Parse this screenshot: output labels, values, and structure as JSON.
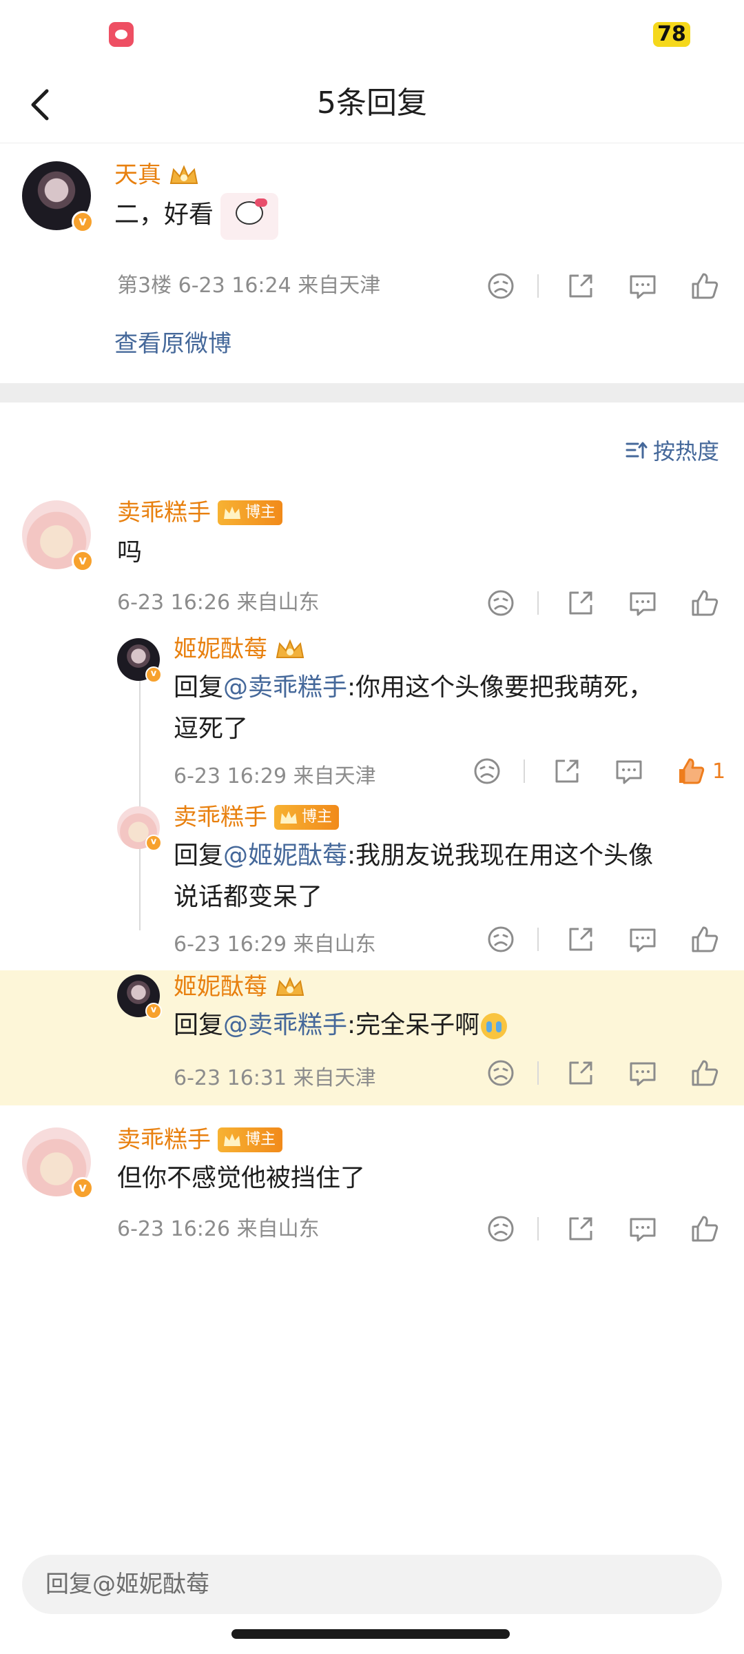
{
  "status_bar": {
    "battery": "78"
  },
  "nav": {
    "title": "5条回复"
  },
  "main_comment": {
    "username": "天真",
    "text": "二，好看",
    "floor": "第3楼",
    "time": "6-23 16:24",
    "location": "来自天津",
    "view_original": "查看原微博"
  },
  "sort": {
    "label": "按热度"
  },
  "badges": {
    "bozhu": "博主"
  },
  "replies": [
    {
      "username": "卖乖糕手",
      "text": "吗",
      "time": "6-23 16:26",
      "location": "来自山东"
    },
    {
      "username": "姬妮酞莓",
      "reply_prefix": "回复",
      "mention": "@卖乖糕手",
      "text": ":你用这个头像要把我萌死，",
      "text2": "逗死了",
      "time": "6-23 16:29",
      "location": "来自天津",
      "likes": "1"
    },
    {
      "username": "卖乖糕手",
      "reply_prefix": "回复",
      "mention": "@姬妮酞莓",
      "text": ":我朋友说我现在用这个头像",
      "text2": "说话都变呆了",
      "time": "6-23 16:29",
      "location": "来自山东"
    },
    {
      "username": "姬妮酞莓",
      "reply_prefix": "回复",
      "mention": "@卖乖糕手",
      "text": ":完全呆子啊",
      "time": "6-23 16:31",
      "location": "来自天津"
    },
    {
      "username": "卖乖糕手",
      "text": "但你不感觉他被挡住了",
      "time": "6-23 16:26",
      "location": "来自山东"
    }
  ],
  "reply_input": {
    "placeholder": "回复@姬妮酞莓"
  },
  "colors": {
    "accent_orange": "#e8800f",
    "link_blue": "#45689a",
    "highlight": "#fdf6d8"
  },
  "icons": [
    "back-icon",
    "dislike-icon",
    "share-icon",
    "comment-icon",
    "like-icon",
    "sort-icon",
    "crown-icon",
    "verified-icon"
  ]
}
